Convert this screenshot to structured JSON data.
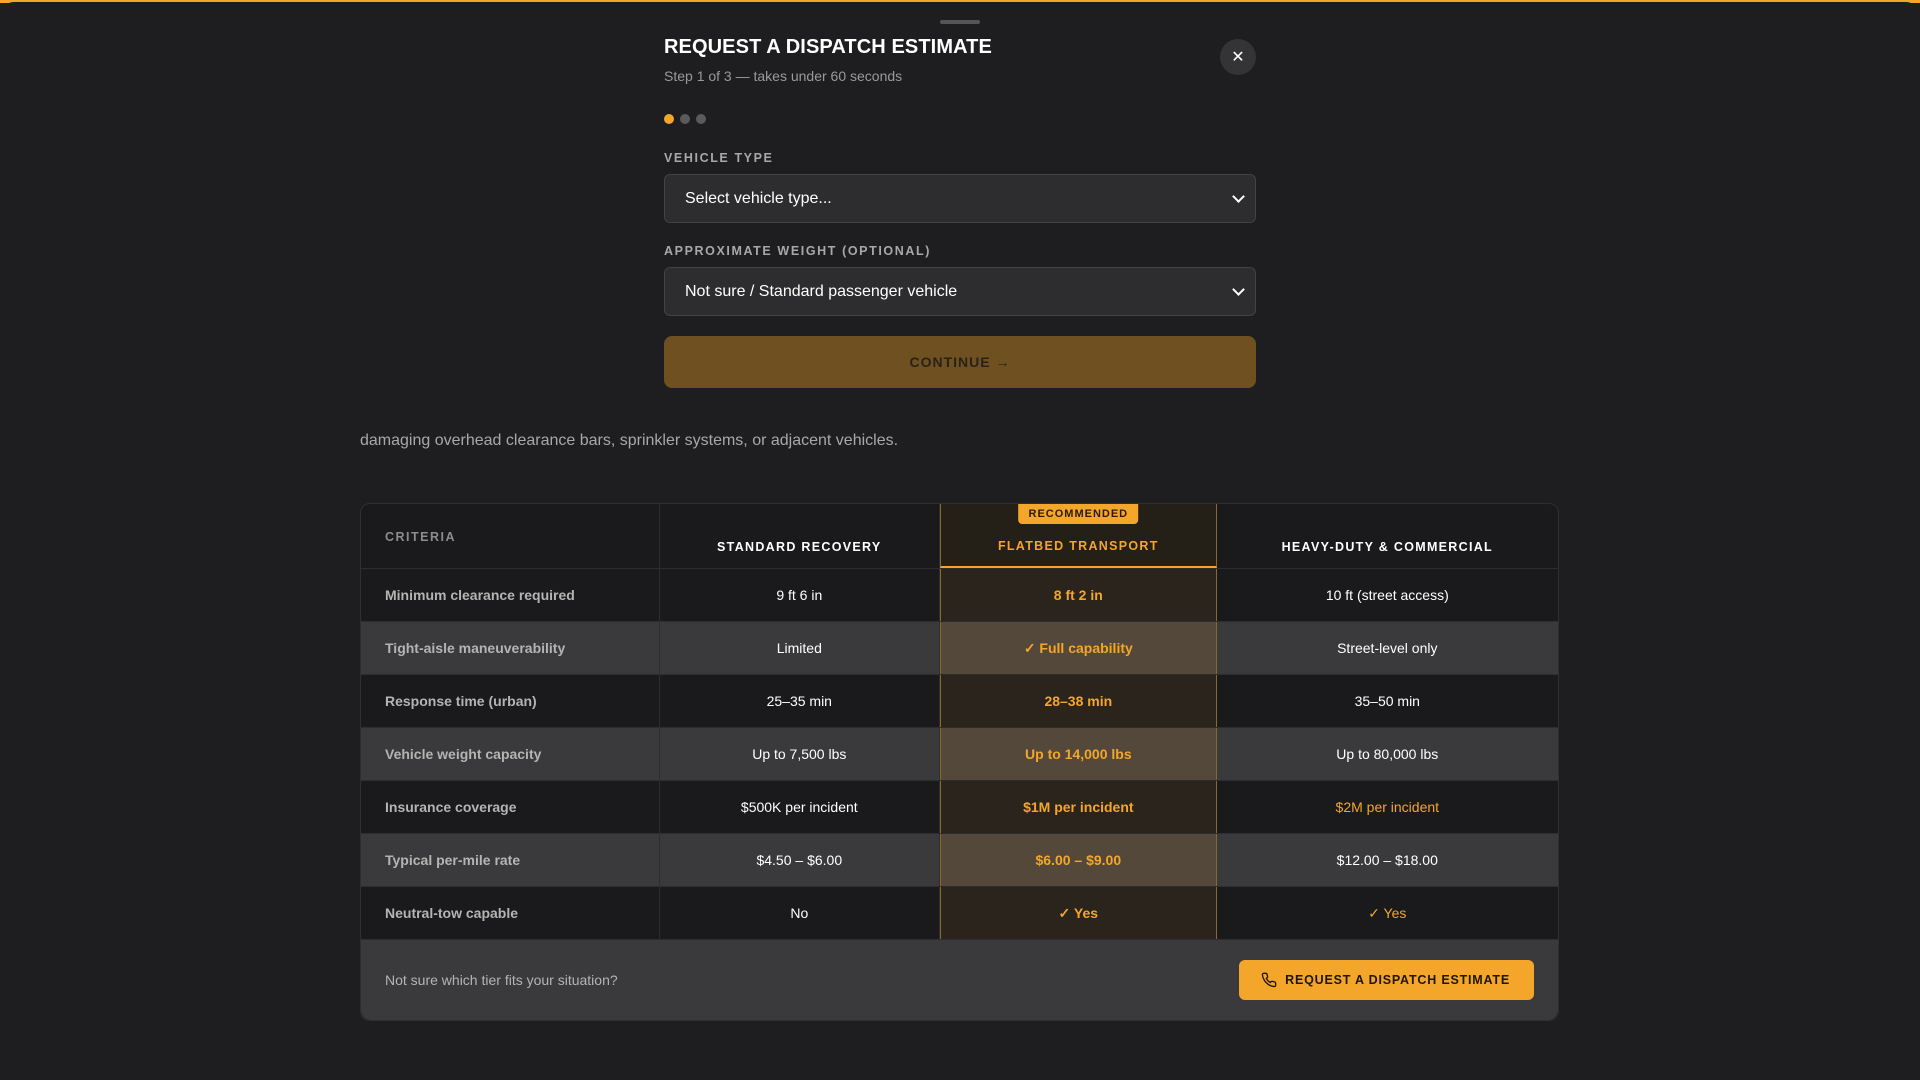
{
  "colors": {
    "accent": "#f4a62a",
    "background": "#1e1e20"
  },
  "modal": {
    "title": "REQUEST A DISPATCH ESTIMATE",
    "subtitle": "Step 1 of 3 — takes under 60 seconds",
    "close_icon": "close-icon",
    "step_current": 1,
    "step_total": 3,
    "vehicle_type": {
      "label": "VEHICLE TYPE",
      "value": "Select vehicle type..."
    },
    "weight": {
      "label": "APPROXIMATE WEIGHT (OPTIONAL)",
      "value": "Not sure / Standard passenger vehicle"
    },
    "continue_label": "CONTINUE →"
  },
  "background_text": "damaging overhead clearance bars, sprinkler systems, or adjacent vehicles.",
  "comparison": {
    "headers": [
      "CRITERIA",
      "STANDARD RECOVERY",
      "FLATBED TRANSPORT",
      "HEAVY-DUTY & COMMERCIAL"
    ],
    "badge": "RECOMMENDED",
    "rows": [
      {
        "criteria": "Minimum clearance required",
        "standard": "9 ft 6 in",
        "flatbed": "8 ft 2 in",
        "heavy": "10 ft (street access)"
      },
      {
        "criteria": "Tight-aisle maneuverability",
        "standard": "Limited",
        "flatbed": "✓ Full capability",
        "heavy": "Street-level only"
      },
      {
        "criteria": "Response time (urban)",
        "standard": "25–35 min",
        "flatbed": "28–38 min",
        "heavy": "35–50 min"
      },
      {
        "criteria": "Vehicle weight capacity",
        "standard": "Up to 7,500 lbs",
        "flatbed": "Up to 14,000 lbs",
        "heavy": "Up to 80,000 lbs"
      },
      {
        "criteria": "Insurance coverage",
        "standard": "$500K per incident",
        "flatbed": "$1M per incident",
        "heavy": "$2M per incident"
      },
      {
        "criteria": "Typical per-mile rate",
        "standard": "$4.50 – $6.00",
        "flatbed": "$6.00 – $9.00",
        "heavy": "$12.00 – $18.00"
      },
      {
        "criteria": "Neutral-tow capable",
        "standard": "No",
        "flatbed": "✓ Yes",
        "heavy": "✓ Yes"
      }
    ],
    "footer_text": "Not sure which tier fits your situation?",
    "cta_label": "REQUEST A DISPATCH ESTIMATE",
    "cta_icon": "phone-icon"
  }
}
